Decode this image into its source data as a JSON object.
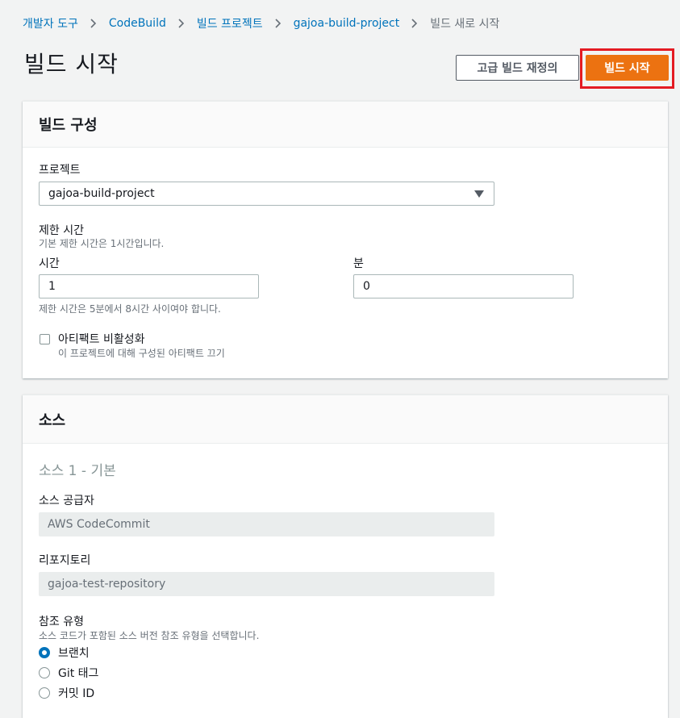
{
  "breadcrumb": {
    "items": [
      "개발자 도구",
      "CodeBuild",
      "빌드 프로젝트",
      "gajoa-build-project"
    ],
    "current": "빌드 새로 시작"
  },
  "header": {
    "title": "빌드 시작",
    "advanced_button": "고급 빌드 재정의",
    "start_button": "빌드 시작"
  },
  "build_config": {
    "title": "빌드 구성",
    "project_label": "프로젝트",
    "project_value": "gajoa-build-project",
    "timeout_label": "제한 시간",
    "timeout_desc": "기본 제한 시간은 1시간입니다.",
    "hours_label": "시간",
    "hours_value": "1",
    "minutes_label": "분",
    "minutes_value": "0",
    "timeout_hint": "제한 시간은 5분에서 8시간 사이여야 합니다.",
    "artifact_label": "아티팩트 비활성화",
    "artifact_desc": "이 프로젝트에 대해 구성된 아티팩트 끄기",
    "artifact_disabled": false
  },
  "source": {
    "title": "소스",
    "subtitle": "소스 1 - 기본",
    "provider_label": "소스 공급자",
    "provider_value": "AWS CodeCommit",
    "repo_label": "리포지토리",
    "repo_value": "gajoa-test-repository",
    "ref_type_label": "참조 유형",
    "ref_type_desc": "소스 코드가 포함된 소스 버전 참조 유형을 선택합니다.",
    "ref_options": [
      "브랜치",
      "Git 태그",
      "커밋 ID"
    ],
    "ref_selected": "브랜치"
  },
  "colors": {
    "primary": "#ec7211",
    "link": "#0073bb",
    "highlight": "#e41b23"
  },
  "icons": {
    "breadcrumb_separator": "chevron-right-icon",
    "select_caret": "caret-down-icon"
  }
}
